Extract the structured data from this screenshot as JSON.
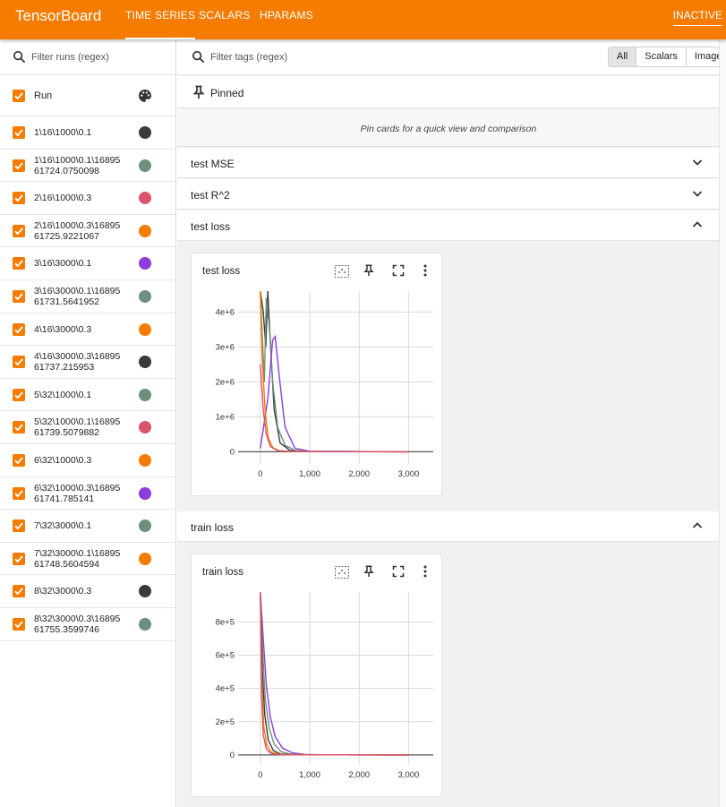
{
  "header": {
    "brand": "TensorBoard",
    "tabs": [
      {
        "label": "TIME SERIES",
        "active": true
      },
      {
        "label": "SCALARS",
        "active": false
      },
      {
        "label": "HPARAMS",
        "active": false
      }
    ],
    "status": "INACTIVE"
  },
  "sidebar": {
    "filter_placeholder": "Filter runs (regex)",
    "run_header": "Run",
    "runs": [
      {
        "name": "1\\16\\1000\\0.1",
        "color": "#3b3b3b"
      },
      {
        "name": "1\\16\\1000\\0.1\\16895\n61724.0750098",
        "color": "#6d8f7b"
      },
      {
        "name": "2\\16\\1000\\0.3",
        "color": "#d9556d"
      },
      {
        "name": "2\\16\\1000\\0.3\\16895\n61725.9221067",
        "color": "#f57c00"
      },
      {
        "name": "3\\16\\3000\\0.1",
        "color": "#8c3ddb"
      },
      {
        "name": "3\\16\\3000\\0.1\\16895\n61731.5641952",
        "color": "#6d8f7b"
      },
      {
        "name": "4\\16\\3000\\0.3",
        "color": "#f57c00"
      },
      {
        "name": "4\\16\\3000\\0.3\\16895\n61737.215953",
        "color": "#3b3b3b"
      },
      {
        "name": "5\\32\\1000\\0.1",
        "color": "#6d8f7b"
      },
      {
        "name": "5\\32\\1000\\0.1\\16895\n61739.5079882",
        "color": "#d9556d"
      },
      {
        "name": "6\\32\\1000\\0.3",
        "color": "#f57c00"
      },
      {
        "name": "6\\32\\1000\\0.3\\16895\n61741.785141",
        "color": "#8c3ddb"
      },
      {
        "name": "7\\32\\3000\\0.1",
        "color": "#6d8f7b"
      },
      {
        "name": "7\\32\\3000\\0.1\\16895\n61748.5604594",
        "color": "#f57c00"
      },
      {
        "name": "8\\32\\3000\\0.3",
        "color": "#3b3b3b"
      },
      {
        "name": "8\\32\\3000\\0.3\\16895\n61755.3599746",
        "color": "#6d8f7b"
      }
    ]
  },
  "main": {
    "filter_placeholder": "Filter tags (regex)",
    "view_toggle": [
      "All",
      "Scalars",
      "Image"
    ],
    "pinned_label": "Pinned",
    "pinned_hint": "Pin cards for a quick view and comparison",
    "groups": [
      {
        "label": "test MSE",
        "expanded": false
      },
      {
        "label": "test R^2",
        "expanded": false
      },
      {
        "label": "test loss",
        "expanded": true
      },
      {
        "label": "train loss",
        "expanded": true
      }
    ],
    "cards": {
      "test_loss_title": "test loss",
      "train_loss_title": "train loss"
    }
  },
  "chart_data": [
    {
      "type": "line",
      "title": "test loss",
      "xticks": [
        "0",
        "1,000",
        "2,000",
        "3,000"
      ],
      "yticks": [
        "0",
        "1e+6",
        "2e+6",
        "3e+6",
        "4e+6"
      ],
      "xlim": [
        -450,
        3500
      ],
      "ylim": [
        -350000,
        4600000
      ],
      "grid": true,
      "series": [
        {
          "color": "#3b3b3b",
          "x": [
            0,
            60,
            110,
            150,
            200,
            280,
            400,
            600,
            1000,
            3000
          ],
          "y": [
            4600000,
            4000000,
            3000000,
            4600000,
            3200000,
            1200000,
            250000,
            40000,
            10000,
            0
          ]
        },
        {
          "color": "#6d8f7b",
          "x": [
            0,
            80,
            120,
            180,
            250,
            350,
            500,
            700,
            1000,
            3000
          ],
          "y": [
            4600000,
            2000000,
            4400000,
            3600000,
            2000000,
            700000,
            180000,
            40000,
            10000,
            0
          ]
        },
        {
          "color": "#8c3ddb",
          "x": [
            0,
            150,
            250,
            300,
            380,
            500,
            700,
            1000,
            3000
          ],
          "y": [
            100000,
            1500000,
            3200000,
            3300000,
            2200000,
            700000,
            100000,
            15000,
            0
          ]
        },
        {
          "color": "#f57c00",
          "x": [
            0,
            40,
            100,
            160,
            250,
            400,
            700,
            3000
          ],
          "y": [
            4600000,
            2600000,
            1100000,
            400000,
            120000,
            20000,
            3000,
            0
          ]
        },
        {
          "color": "#d9556d",
          "x": [
            0,
            60,
            120,
            200,
            350,
            700,
            3000
          ],
          "y": [
            2500000,
            1200000,
            500000,
            150000,
            30000,
            3000,
            0
          ]
        }
      ]
    },
    {
      "type": "line",
      "title": "train loss",
      "xticks": [
        "0",
        "1,000",
        "2,000",
        "3,000"
      ],
      "yticks": [
        "0",
        "2e+5",
        "4e+5",
        "6e+5",
        "8e+5"
      ],
      "xlim": [
        -450,
        3500
      ],
      "ylim": [
        -60000,
        980000
      ],
      "grid": true,
      "series": [
        {
          "color": "#8c3ddb",
          "x": [
            0,
            60,
            120,
            200,
            300,
            450,
            650,
            900,
            1200,
            3000
          ],
          "y": [
            980000,
            700000,
            420000,
            230000,
            110000,
            40000,
            12000,
            3000,
            800,
            0
          ]
        },
        {
          "color": "#6d8f7b",
          "x": [
            0,
            50,
            100,
            180,
            280,
            420,
            600,
            900,
            3000
          ],
          "y": [
            980000,
            600000,
            330000,
            160000,
            65000,
            20000,
            5000,
            1000,
            0
          ]
        },
        {
          "color": "#3b3b3b",
          "x": [
            0,
            40,
            90,
            160,
            260,
            400,
            700,
            3000
          ],
          "y": [
            980000,
            500000,
            240000,
            90000,
            28000,
            6000,
            800,
            0
          ]
        },
        {
          "color": "#f57c00",
          "x": [
            0,
            30,
            70,
            130,
            220,
            380,
            700,
            3000
          ],
          "y": [
            980000,
            420000,
            170000,
            60000,
            17000,
            3000,
            300,
            0
          ]
        },
        {
          "color": "#d9556d",
          "x": [
            0,
            25,
            60,
            120,
            220,
            400,
            3000
          ],
          "y": [
            980000,
            350000,
            120000,
            35000,
            8000,
            1000,
            0
          ]
        }
      ]
    }
  ]
}
